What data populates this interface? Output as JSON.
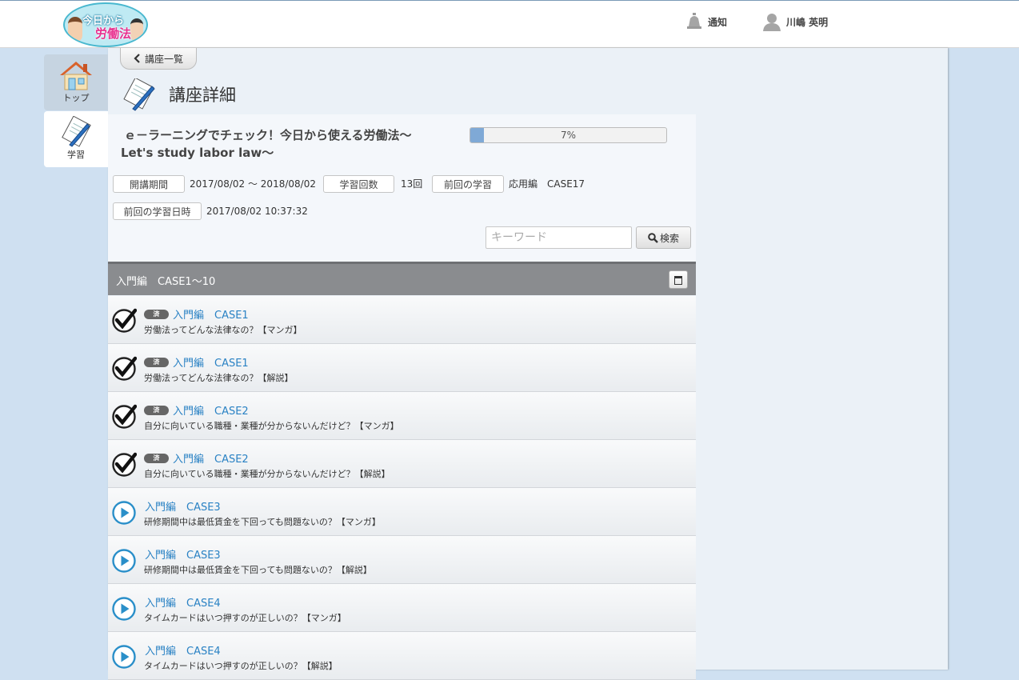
{
  "header": {
    "logo": {
      "top_text": "今日から",
      "main_text": "労働法"
    },
    "notification_label": "通知",
    "user_name": "川嶋 英明"
  },
  "side_nav": [
    {
      "label": "トップ",
      "icon": "home-icon"
    },
    {
      "label": "学習",
      "icon": "notebook-pen-icon"
    }
  ],
  "back_button_label": "講座一覧",
  "page_title": "講座詳細",
  "course": {
    "title_line1": "ｅ－ラーニングでチェック！今日から使える労働法～",
    "title_line2": "Let's study labor law～",
    "progress_percent": 7,
    "progress_label": "7%",
    "period_label": "開講期間",
    "period_value": "2017/08/02 ～ 2018/08/02",
    "count_label": "学習回数",
    "count_value": "13回",
    "last_label": "前回の学習",
    "last_value": "応用編　CASE17",
    "last_date_label": "前回の学習日時",
    "last_date_value": "2017/08/02 10:37:32"
  },
  "search": {
    "placeholder": "キーワード",
    "button_label": "検索"
  },
  "section": {
    "title": "入門編　CASE1～10"
  },
  "lessons": [
    {
      "done": true,
      "badge": "済",
      "title": "入門編　CASE1",
      "subtitle": "労働法ってどんな法律なの？【マンガ】"
    },
    {
      "done": true,
      "badge": "済",
      "title": "入門編　CASE1",
      "subtitle": "労働法ってどんな法律なの？【解説】"
    },
    {
      "done": true,
      "badge": "済",
      "title": "入門編　CASE2",
      "subtitle": "自分に向いている職種・業種が分からないんだけど？【マンガ】"
    },
    {
      "done": true,
      "badge": "済",
      "title": "入門編　CASE2",
      "subtitle": "自分に向いている職種・業種が分からないんだけど？【解説】"
    },
    {
      "done": false,
      "badge": "",
      "title": "入門編　CASE3",
      "subtitle": "研修期間中は最低賃金を下回っても問題ないの？【マンガ】"
    },
    {
      "done": false,
      "badge": "",
      "title": "入門編　CASE3",
      "subtitle": "研修期間中は最低賃金を下回っても問題ないの？【解説】"
    },
    {
      "done": false,
      "badge": "",
      "title": "入門編　CASE4",
      "subtitle": "タイムカードはいつ押すのが正しいの？【マンガ】"
    },
    {
      "done": false,
      "badge": "",
      "title": "入門編　CASE4",
      "subtitle": "タイムカードはいつ押すのが正しいの？【解説】"
    }
  ],
  "colors": {
    "link": "#2a82c4",
    "section_bg": "#8a8c8f",
    "page_bg": "#cfe0f1",
    "progress_fill": "#7fa9d6"
  }
}
